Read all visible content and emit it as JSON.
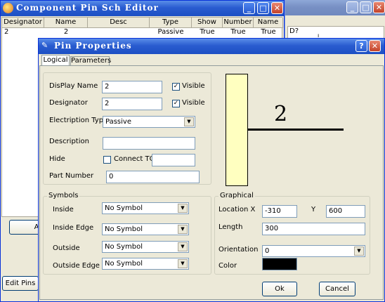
{
  "editor": {
    "title": "Component Pin Sch Editor",
    "columns": [
      "Designator",
      "Name",
      "Desc",
      "Type",
      "Show",
      "Number",
      "Name"
    ],
    "row": [
      "2",
      "2",
      "",
      "Passive",
      "True",
      "True",
      "True"
    ],
    "add_button": "Add",
    "edit_pins_button": "Edit Pins"
  },
  "back_window": {
    "col_label": "D?",
    "col_mark": "ı"
  },
  "dialog": {
    "title": "Pin Properties",
    "tabs": [
      "Logical",
      "Parameters"
    ],
    "logical": {
      "display_name_label": "DisPlay Name",
      "display_name_value": "2",
      "visible_label": "Visible",
      "designator_label": "Designator",
      "designator_value": "2",
      "visible2_label": "Visible",
      "electrical_type_label": "Electription Typ",
      "electrical_type_value": "Passive",
      "description_label": "Description",
      "description_value": "",
      "hide_label": "Hide",
      "connect_to_label": "Connect TO",
      "connect_to_value": "",
      "part_number_label": "Part Number",
      "part_number_value": "0"
    },
    "symbols": {
      "group_label": "Symbols",
      "inside_label": "Inside",
      "inside_value": "No Symbol",
      "inside_edge_label": "Inside Edge",
      "inside_edge_value": "No Symbol",
      "outside_label": "Outside",
      "outside_value": "No Symbol",
      "outside_edge_label": "Outside Edge",
      "outside_edge_value": "No Symbol"
    },
    "graphical": {
      "group_label": "Graphical",
      "location_label": "Location X",
      "x_value": "-310",
      "y_label": "Y",
      "y_value": "600",
      "length_label": "Length",
      "length_value": "300",
      "orientation_label": "Orientation",
      "orientation_value": "0",
      "color_label": "Color",
      "color_value": "#000000"
    },
    "preview_pin_number": "2",
    "ok_label": "Ok",
    "cancel_label": "Cancel"
  }
}
